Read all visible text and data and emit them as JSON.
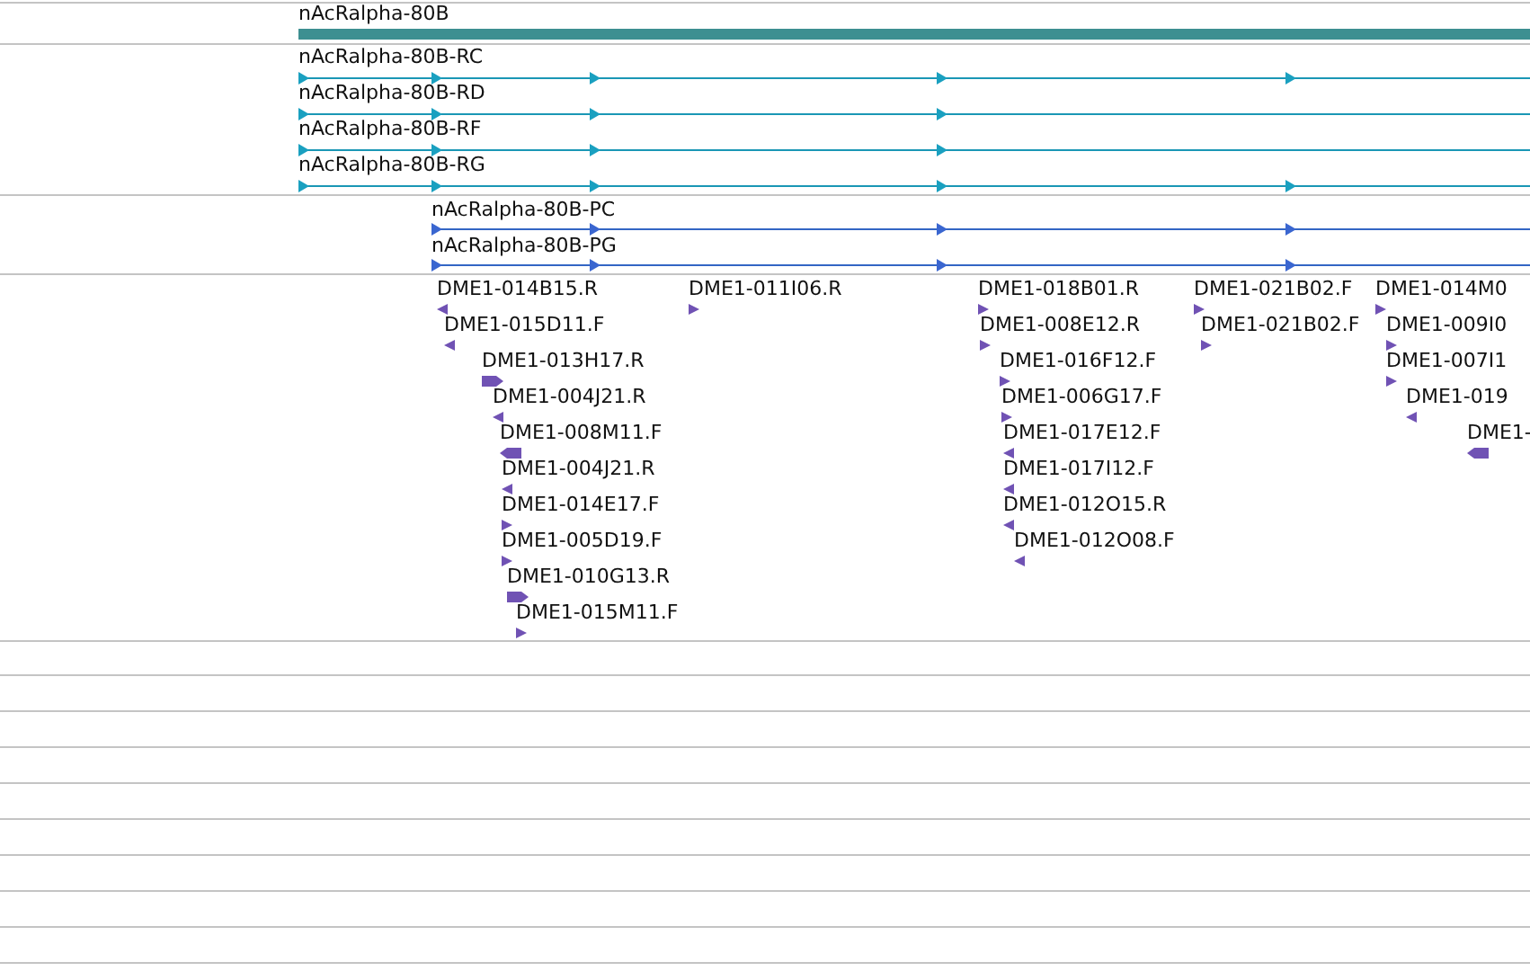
{
  "gene_track": {
    "label": "nAcRalpha-80B"
  },
  "transcript_track": {
    "transcripts": [
      {
        "label": "nAcRalpha-80B-RC"
      },
      {
        "label": "nAcRalpha-80B-RD"
      },
      {
        "label": "nAcRalpha-80B-RF"
      },
      {
        "label": "nAcRalpha-80B-RG"
      }
    ]
  },
  "protein_track": {
    "proteins": [
      {
        "label": "nAcRalpha-80B-PC"
      },
      {
        "label": "nAcRalpha-80B-PG"
      }
    ]
  },
  "est_track": {
    "ests": [
      {
        "label": "DME1-014B15.R",
        "kind": "reverse"
      },
      {
        "label": "DME1-015D11.F",
        "kind": "reverse"
      },
      {
        "label": "DME1-013H17.R",
        "kind": "forward"
      },
      {
        "label": "DME1-004J21.R",
        "kind": "reverse"
      },
      {
        "label": "DME1-008M11.F",
        "kind": "reverse"
      },
      {
        "label": "DME1-004J21.R",
        "kind": "reverse"
      },
      {
        "label": "DME1-014E17.F",
        "kind": "forward"
      },
      {
        "label": "DME1-005D19.F",
        "kind": "forward"
      },
      {
        "label": "DME1-010G13.R",
        "kind": "forward"
      },
      {
        "label": "DME1-015M11.F",
        "kind": "forward"
      },
      {
        "label": "DME1-011I06.R",
        "kind": "forward"
      },
      {
        "label": "DME1-018B01.R",
        "kind": "forward"
      },
      {
        "label": "DME1-008E12.R",
        "kind": "forward"
      },
      {
        "label": "DME1-016F12.F",
        "kind": "forward"
      },
      {
        "label": "DME1-006G17.F",
        "kind": "forward"
      },
      {
        "label": "DME1-017E12.F",
        "kind": "reverse"
      },
      {
        "label": "DME1-017I12.F",
        "kind": "reverse"
      },
      {
        "label": "DME1-012O15.R",
        "kind": "reverse"
      },
      {
        "label": "DME1-012O08.F",
        "kind": "reverse"
      },
      {
        "label": "DME1-021B02.F",
        "kind": "forward"
      },
      {
        "label": "DME1-021B02.F",
        "kind": "forward"
      },
      {
        "label": "DME1-014M0",
        "kind": "forward"
      },
      {
        "label": "DME1-009I0",
        "kind": "forward"
      },
      {
        "label": "DME1-007I1",
        "kind": "forward"
      },
      {
        "label": "DME1-019",
        "kind": "reverse"
      },
      {
        "label": "DME1-",
        "kind": "reverse"
      }
    ]
  }
}
